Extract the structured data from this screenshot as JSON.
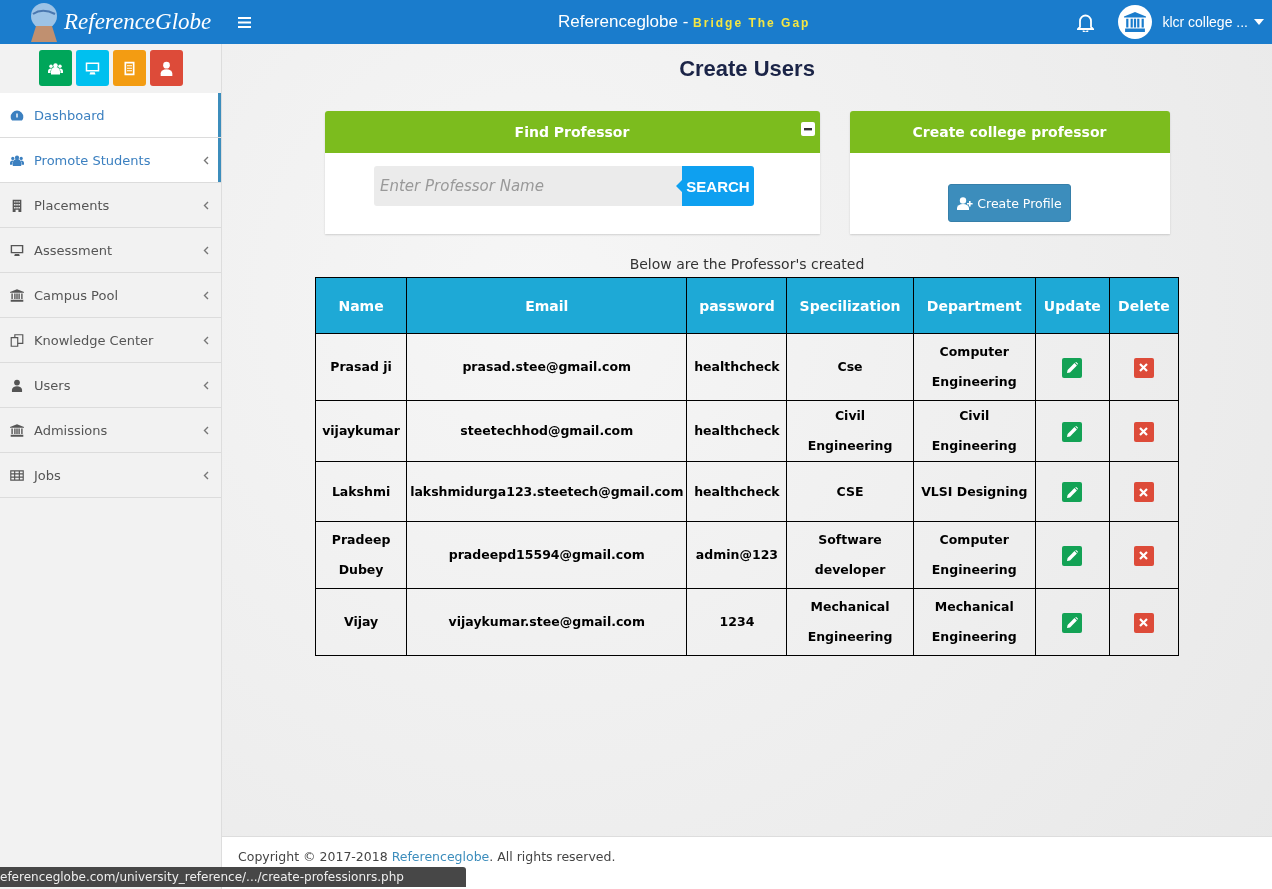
{
  "header": {
    "brand": "ReferenceGlobe",
    "title": "Referenceglobe - ",
    "tagline": "Bridge The Gap",
    "user": "klcr college ..."
  },
  "quick_buttons": [
    {
      "kind": "users",
      "color": "#00a65a"
    },
    {
      "kind": "monitor",
      "color": "#00c0ef"
    },
    {
      "kind": "document",
      "color": "#f39c12"
    },
    {
      "kind": "user",
      "color": "#dd4b39"
    }
  ],
  "sidebar": {
    "items": [
      {
        "label": "Dashboard",
        "kind": "gauge",
        "selected": true,
        "expandable": false
      },
      {
        "label": "Promote Students",
        "kind": "users",
        "selected": true,
        "expandable": true
      },
      {
        "label": "Placements",
        "kind": "building",
        "selected": false,
        "expandable": true
      },
      {
        "label": "Assessment",
        "kind": "monitor",
        "selected": false,
        "expandable": true
      },
      {
        "label": "Campus Pool",
        "kind": "bank",
        "selected": false,
        "expandable": true
      },
      {
        "label": "Knowledge Center",
        "kind": "documents",
        "selected": false,
        "expandable": true
      },
      {
        "label": "Users",
        "kind": "user",
        "selected": false,
        "expandable": true
      },
      {
        "label": "Admissions",
        "kind": "bank",
        "selected": false,
        "expandable": true
      },
      {
        "label": "Jobs",
        "kind": "table",
        "selected": false,
        "expandable": true
      }
    ]
  },
  "page_title": "Create Users",
  "find_panel": {
    "title": "Find Professor",
    "placeholder": "Enter Professor Name",
    "button": "SEARCH"
  },
  "create_panel": {
    "title": "Create college professor",
    "button": "Create Profile"
  },
  "caption": "Below are the Professor's created",
  "table": {
    "columns": [
      "Name",
      "Email",
      "password",
      "Specilization",
      "Department",
      "Update",
      "Delete"
    ],
    "rows": [
      {
        "name": "Prasad ji",
        "email": "prasad.stee@gmail.com",
        "password": "healthcheck",
        "specialization": "Cse",
        "department": "Computer Engineering"
      },
      {
        "name": "vijaykumar",
        "email": "steetechhod@gmail.com",
        "password": "healthcheck",
        "specialization": "Civil Engineering",
        "department": "Civil Engineering"
      },
      {
        "name": "Lakshmi",
        "email": "lakshmidurga123.steetech@gmail.com",
        "password": "healthcheck",
        "specialization": "CSE",
        "department": "VLSI Designing"
      },
      {
        "name": "Pradeep Dubey",
        "email": "pradeepd15594@gmail.com",
        "password": "admin@123",
        "specialization": "Software developer",
        "department": "Computer Engineering"
      },
      {
        "name": "Vijay",
        "email": "vijaykumar.stee@gmail.com",
        "password": "1234",
        "specialization": "Mechanical Engineering",
        "department": "Mechanical Engineering"
      }
    ]
  },
  "footer": {
    "prefix": "Copyright © 2017-2018 ",
    "link": "Referenceglobe",
    "suffix": ". All rights reserved."
  },
  "status_url": "eferenceglobe.com/university_reference/.../create-professionrs.php"
}
